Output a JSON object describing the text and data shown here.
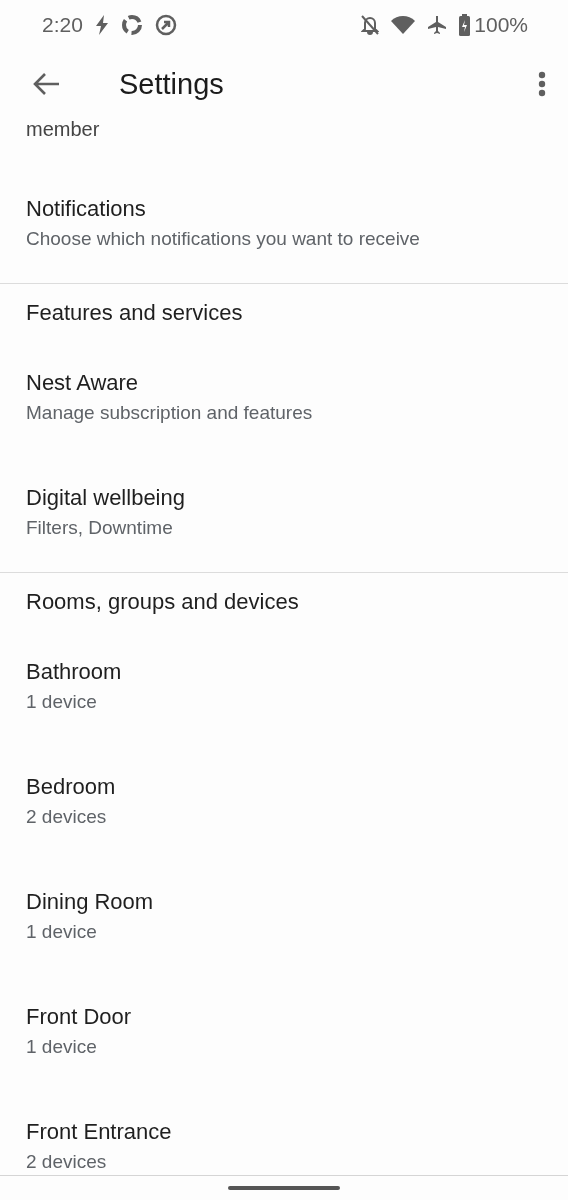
{
  "status_bar": {
    "time": "2:20",
    "battery": "100%"
  },
  "app_bar": {
    "title": "Settings"
  },
  "list": [
    {
      "kind": "fragment",
      "text": "member"
    },
    {
      "kind": "item",
      "title": "Notifications",
      "subtitle": "Choose which notifications you want to receive"
    },
    {
      "kind": "header",
      "title": "Features and services"
    },
    {
      "kind": "item",
      "title": "Nest Aware",
      "subtitle": "Manage subscription and features"
    },
    {
      "kind": "item",
      "title": "Digital wellbeing",
      "subtitle": "Filters, Downtime"
    },
    {
      "kind": "header",
      "title": "Rooms, groups and devices"
    },
    {
      "kind": "item",
      "title": "Bathroom",
      "subtitle": "1 device"
    },
    {
      "kind": "item",
      "title": "Bedroom",
      "subtitle": "2 devices"
    },
    {
      "kind": "item",
      "title": "Dining Room",
      "subtitle": "1 device"
    },
    {
      "kind": "item",
      "title": "Front Door",
      "subtitle": "1 device"
    },
    {
      "kind": "item",
      "title": "Front Entrance",
      "subtitle": "2 devices"
    }
  ]
}
